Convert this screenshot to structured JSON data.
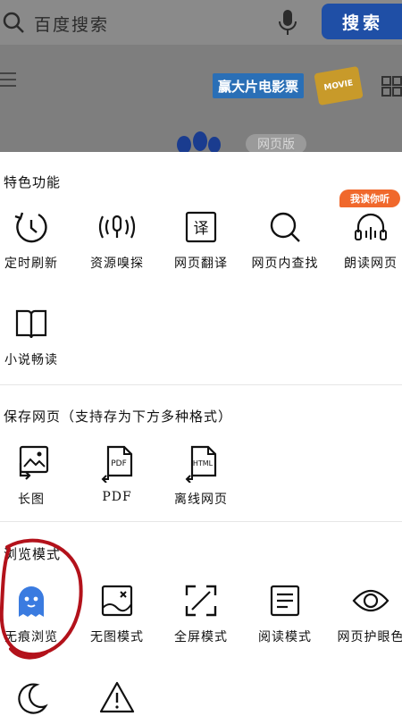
{
  "search": {
    "placeholder": "百度搜索",
    "button": "搜索"
  },
  "promo": {
    "text": "赢大片电影票",
    "ticket": "MOVIE"
  },
  "web_pill": "网页版",
  "sections": {
    "features": {
      "title": "特色功能",
      "badge": "我读你听",
      "items": [
        "定时刷新",
        "资源嗅探",
        "网页翻译",
        "网页内查找",
        "朗读网页",
        "小说畅读"
      ]
    },
    "save": {
      "title": "保存网页（支持存为下方多种格式）",
      "items": [
        "长图",
        "PDF",
        "离线网页"
      ]
    },
    "browse": {
      "title": "浏览模式",
      "items": [
        "无痕浏览",
        "无图模式",
        "全屏模式",
        "阅读模式",
        "网页护眼色"
      ]
    }
  },
  "icons": {
    "pdf": "PDF",
    "html": "HTML",
    "translate": "译"
  },
  "colors": {
    "accent_blue": "#3a7be0",
    "annotation_red": "#b3121b",
    "badge_orange": "#f0682c"
  }
}
